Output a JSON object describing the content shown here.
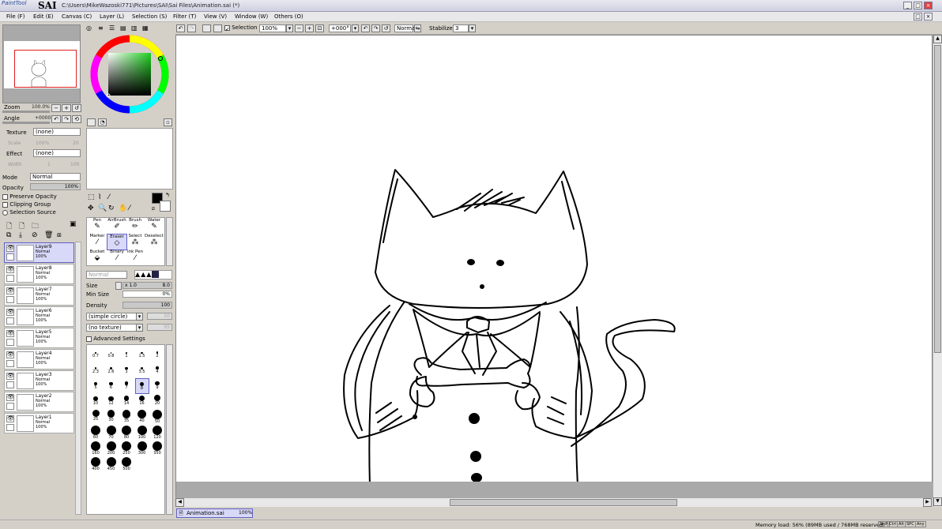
{
  "app": {
    "logo_prefix": "PaintTool",
    "logo_name": "SAI",
    "title_path": "C:\\Users\\MikeWazoski771\\Pictures\\SAI\\Sai Files\\Animation.sai (*)"
  },
  "menu": [
    "File (F)",
    "Edit (E)",
    "Canvas (C)",
    "Layer (L)",
    "Selection (S)",
    "Filter (T)",
    "View (V)",
    "Window (W)",
    "Others (O)"
  ],
  "navigator": {
    "zoom_label": "Zoom",
    "zoom_value": "100.0%",
    "angle_label": "Angle",
    "angle_value": "+0000"
  },
  "layer_props": {
    "texture_label": "Texture",
    "texture_value": "(none)",
    "scale_label": "Scale",
    "scale_value": "100%",
    "scale_num": "20",
    "effect_label": "Effect",
    "effect_value": "(none)",
    "width_label": "Width",
    "width_value": "1",
    "width_num": "100",
    "mode_label": "Mode",
    "mode_value": "Normal",
    "opacity_label": "Opacity",
    "opacity_value": "100%",
    "preserve_opacity": "Preserve Opacity",
    "clipping_group": "Clipping Group",
    "selection_source": "Selection Source"
  },
  "layers": [
    {
      "name": "Layer9",
      "mode": "Normal",
      "opacity": "100%"
    },
    {
      "name": "Layer8",
      "mode": "Normal",
      "opacity": "100%"
    },
    {
      "name": "Layer7",
      "mode": "Normal",
      "opacity": "100%"
    },
    {
      "name": "Layer6",
      "mode": "Normal",
      "opacity": "100%"
    },
    {
      "name": "Layer5",
      "mode": "Normal",
      "opacity": "100%"
    },
    {
      "name": "Layer4",
      "mode": "Normal",
      "opacity": "100%"
    },
    {
      "name": "Layer3",
      "mode": "Normal",
      "opacity": "100%"
    },
    {
      "name": "Layer2",
      "mode": "Normal",
      "opacity": "100%"
    },
    {
      "name": "Layer1",
      "mode": "Normal",
      "opacity": "100%"
    }
  ],
  "tools": {
    "row1": [
      "Pen",
      "AirBrush",
      "Brush",
      "Water"
    ],
    "row2": [
      "Marker",
      "Eraser",
      "Select",
      "Deselect"
    ],
    "row3": [
      "Bucket",
      "Binary",
      "Ink Pen"
    ]
  },
  "brush_settings": {
    "blend_mode": "Normal",
    "size_label": "Size",
    "size_mult": "x 1.0",
    "size_value": "8.0",
    "min_size_label": "Min Size",
    "min_size_value": "0%",
    "density_label": "Density",
    "density_value": "100",
    "shape": "(simple circle)",
    "shape_num": "50",
    "texture": "(no texture)",
    "texture_num": "95",
    "advanced": "Advanced Settings"
  },
  "brush_sizes": [
    "0.7",
    "0.8",
    "1",
    "1.5",
    "2",
    "2.3",
    "2.6",
    "3",
    "3.5",
    "4",
    "5",
    "6",
    "7",
    "8",
    "9",
    "10",
    "12",
    "14",
    "16",
    "20",
    "25",
    "30",
    "35",
    "40",
    "50",
    "60",
    "70",
    "80",
    "100",
    "120",
    "160",
    "200",
    "250",
    "300",
    "350",
    "400",
    "450",
    "500"
  ],
  "toolbar": {
    "selection_label": "Selection",
    "zoom": "100%",
    "angle": "+000°",
    "mode": "Normal",
    "stabilizer_label": "Stabilizer",
    "stabilizer_value": "3"
  },
  "tab": {
    "name": "Animation.sai",
    "zoom": "100%"
  },
  "status": {
    "memory": "Memory load: 56% (89MB used / 768MB reserved)",
    "keys": [
      "Shift",
      "Ctrl",
      "Alt",
      "SPC",
      "Any"
    ]
  },
  "colors": {
    "accent": "#6060c0",
    "canvas_bg": "#ffffff",
    "panel_bg": "#d4d0c8",
    "selected_layer": "#d8d8f8"
  }
}
